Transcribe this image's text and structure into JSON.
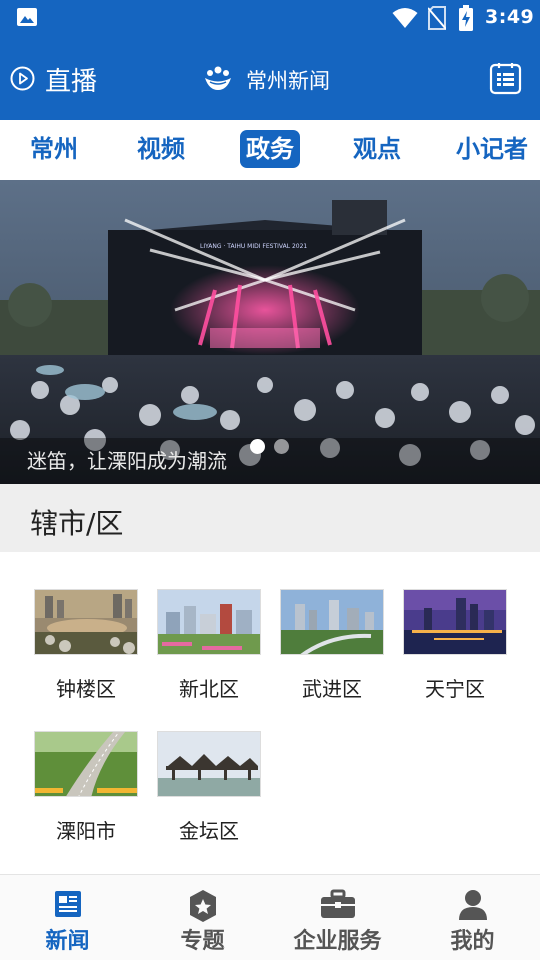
{
  "status_bar": {
    "time": "3:49",
    "icons": [
      "image-icon",
      "wifi-icon",
      "no-sim-icon",
      "battery-charging-icon"
    ]
  },
  "header": {
    "live_label": "直播",
    "app_title": "常州新闻",
    "icons": [
      "play-circle-icon",
      "app-logo-icon",
      "menu-list-icon"
    ]
  },
  "tabs": [
    {
      "label": "常州",
      "active": false
    },
    {
      "label": "视频",
      "active": false
    },
    {
      "label": "政务",
      "active": true
    },
    {
      "label": "观点",
      "active": false
    },
    {
      "label": "小记者",
      "active": false
    }
  ],
  "banner": {
    "caption": "迷笛，让溧阳成为潮流",
    "stage_sign": "LIYANG · TAIHU MIDI FESTIVAL 2021",
    "slide_count": 2,
    "active_slide": 1
  },
  "section": {
    "title": "辖市/区"
  },
  "districts": [
    {
      "name": "钟楼区"
    },
    {
      "name": "新北区"
    },
    {
      "name": "武进区"
    },
    {
      "name": "天宁区"
    },
    {
      "name": "溧阳市"
    },
    {
      "name": "金坛区"
    }
  ],
  "bottom_nav": [
    {
      "label": "新闻",
      "icon": "newspaper-icon",
      "active": true
    },
    {
      "label": "专题",
      "icon": "star-badge-icon",
      "active": false
    },
    {
      "label": "企业服务",
      "icon": "briefcase-icon",
      "active": false
    },
    {
      "label": "我的",
      "icon": "person-icon",
      "active": false
    }
  ],
  "colors": {
    "brand_blue": "#1565c0",
    "nav_inactive": "#555555",
    "section_bg": "#eeeeee"
  }
}
